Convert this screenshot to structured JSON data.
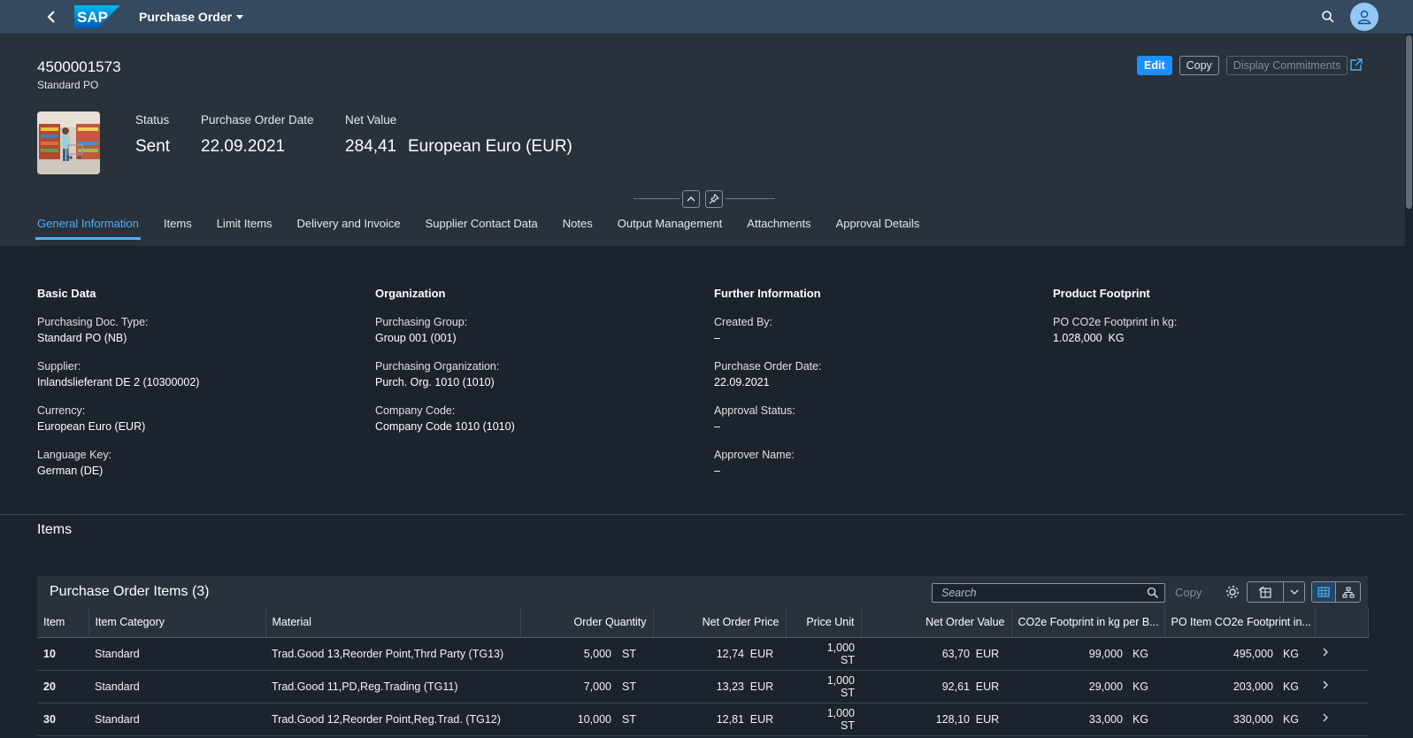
{
  "shell": {
    "logo_text": "SAP",
    "app_title": "Purchase Order"
  },
  "header": {
    "po_number": "4500001573",
    "po_type": "Standard PO",
    "kpis": [
      {
        "label": "Status",
        "value": "Sent"
      },
      {
        "label": "Purchase Order Date",
        "value": "22.09.2021"
      },
      {
        "label": "Net Value",
        "value": "284,41",
        "unit": "European Euro (EUR)"
      }
    ],
    "actions": {
      "edit": "Edit",
      "copy": "Copy",
      "display_commitments": "Display Commitments"
    }
  },
  "tabs": [
    {
      "label": "General Information",
      "active": true
    },
    {
      "label": "Items"
    },
    {
      "label": "Limit Items"
    },
    {
      "label": "Delivery and Invoice"
    },
    {
      "label": "Supplier Contact Data"
    },
    {
      "label": "Notes"
    },
    {
      "label": "Output Management"
    },
    {
      "label": "Attachments"
    },
    {
      "label": "Approval Details"
    }
  ],
  "general": {
    "basic": {
      "title": "Basic Data",
      "fields": [
        {
          "label": "Purchasing Doc. Type:",
          "value": "Standard PO (NB)"
        },
        {
          "label": "Supplier:",
          "value": "Inlandslieferant DE 2 (10300002)"
        },
        {
          "label": "Currency:",
          "value": "European Euro (EUR)"
        },
        {
          "label": "Language Key:",
          "value": "German (DE)"
        }
      ]
    },
    "org": {
      "title": "Organization",
      "fields": [
        {
          "label": "Purchasing Group:",
          "value": "Group 001 (001)"
        },
        {
          "label": "Purchasing Organization:",
          "value": "Purch. Org. 1010 (1010)"
        },
        {
          "label": "Company Code:",
          "value": "Company Code 1010 (1010)"
        }
      ]
    },
    "further": {
      "title": "Further Information",
      "fields": [
        {
          "label": "Created By:",
          "value": "–"
        },
        {
          "label": "Purchase Order Date:",
          "value": "22.09.2021"
        },
        {
          "label": "Approval Status:",
          "value": "–"
        },
        {
          "label": "Approver Name:",
          "value": "–"
        }
      ]
    },
    "footprint": {
      "title": "Product Footprint",
      "fields": [
        {
          "label": "PO CO2e Footprint in kg:",
          "value": "1.028,000  KG"
        }
      ]
    }
  },
  "items": {
    "section_title": "Items",
    "table_title": "Purchase Order Items (3)",
    "search_placeholder": "Search",
    "copy_label": "Copy",
    "columns": [
      "Item",
      "Item Category",
      "Material",
      "Order Quantity",
      "Net Order Price",
      "Price Unit",
      "Net Order Value",
      "CO2e Footprint in kg per B...",
      "PO Item CO2e Footprint in..."
    ],
    "rows": [
      {
        "item": "10",
        "category": "Standard",
        "material": "Trad.Good 13,Reorder Point,Thrd Party (TG13)",
        "qty": "5,000",
        "qty_unit": "ST",
        "price": "12,74",
        "price_cur": "EUR",
        "pu_qty": "1,000",
        "pu_unit": "ST",
        "value": "63,70",
        "value_cur": "EUR",
        "co2_per": "99,000",
        "co2_per_unit": "KG",
        "co2_item": "495,000",
        "co2_item_unit": "KG"
      },
      {
        "item": "20",
        "category": "Standard",
        "material": "Trad.Good 11,PD,Reg.Trading (TG11)",
        "qty": "7,000",
        "qty_unit": "ST",
        "price": "13,23",
        "price_cur": "EUR",
        "pu_qty": "1,000",
        "pu_unit": "ST",
        "value": "92,61",
        "value_cur": "EUR",
        "co2_per": "29,000",
        "co2_per_unit": "KG",
        "co2_item": "203,000",
        "co2_item_unit": "KG"
      },
      {
        "item": "30",
        "category": "Standard",
        "material": "Trad.Good 12,Reorder Point,Reg.Trad. (TG12)",
        "qty": "10,000",
        "qty_unit": "ST",
        "price": "12,81",
        "price_cur": "EUR",
        "pu_qty": "1,000",
        "pu_unit": "ST",
        "value": "128,10",
        "value_cur": "EUR",
        "co2_per": "33,000",
        "co2_per_unit": "KG",
        "co2_item": "330,000",
        "co2_item_unit": "KG"
      }
    ]
  },
  "colors": {
    "shell": "#354a5f",
    "header": "#29313a",
    "background": "#1d232c",
    "accent": "#1b90ff",
    "tab_active": "#4db1ff"
  }
}
